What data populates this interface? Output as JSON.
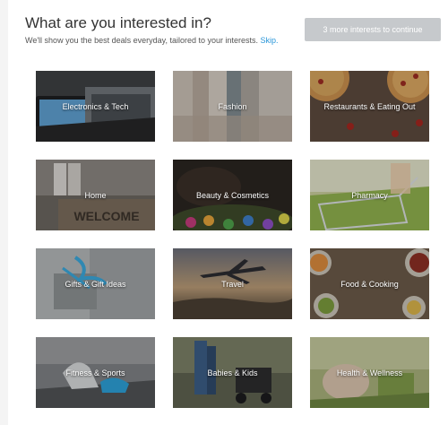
{
  "header": {
    "title": "What are you interested in?",
    "subtitle": "We'll show you the best deals everyday, tailored to your interests.",
    "skip_label": "Skip.",
    "cta_label": "3 more interests to continue"
  },
  "categories": [
    {
      "label": "Electronics & Tech"
    },
    {
      "label": "Fashion"
    },
    {
      "label": "Restaurants & Eating Out"
    },
    {
      "label": "Home"
    },
    {
      "label": "Beauty & Cosmetics"
    },
    {
      "label": "Pharmacy"
    },
    {
      "label": "Gifts & Gift Ideas"
    },
    {
      "label": "Travel"
    },
    {
      "label": "Food & Cooking"
    },
    {
      "label": "Fitness & Sports"
    },
    {
      "label": "Babies & Kids"
    },
    {
      "label": "Health & Wellness"
    }
  ]
}
